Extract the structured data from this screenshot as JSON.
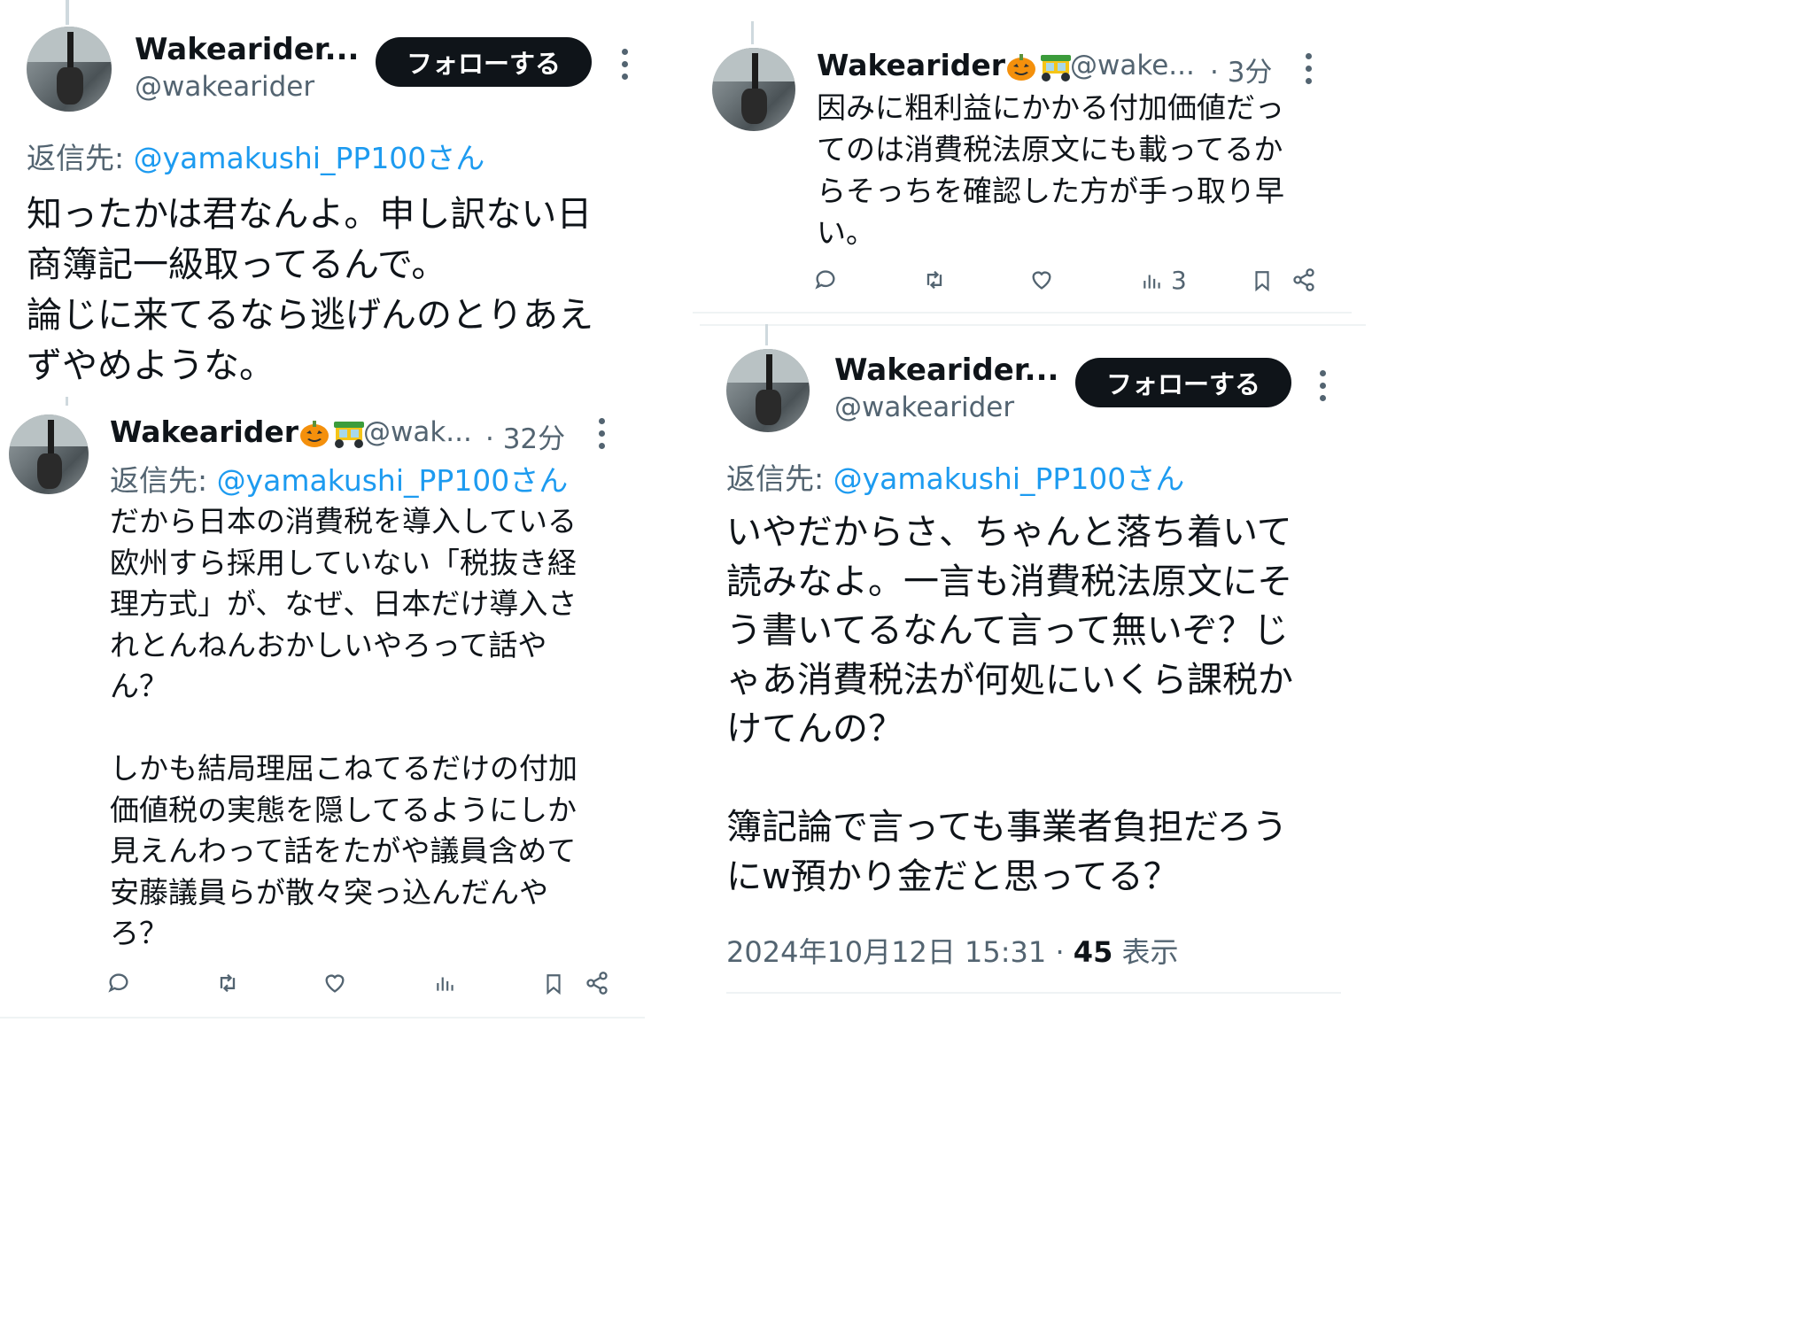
{
  "tweet_a": {
    "name": "Wakearider...",
    "handle": "@wakearider",
    "follow_label": "フォローする",
    "reply_prefix": "返信先: ",
    "reply_mention": "@yamakushi_PP100さん",
    "text": "知ったかは君なんよ。申し訳ない日\n商簿記一級取ってるんで。\n論じに来てるなら逃げんのとりあえ\nずやめような。"
  },
  "tweet_b": {
    "name": "Wakearider",
    "handle": "@wak...",
    "time": "· 32分",
    "reply_prefix": "返信先: ",
    "reply_mention": "@yamakushi_PP100さん",
    "text": "だから日本の消費税を導入している\n欧州すら採用していない「税抜き経\n理方式」が、なぜ、日本だけ導入さ\nれとんねんおかしいやろって話や\nん？\n\nしかも結局理屈こねてるだけの付加\n価値税の実態を隠してるようにしか\n見えんわって話をたがや議員含めて\n安藤議員らが散々突っ込んだんや\nろ？",
    "views": ""
  },
  "tweet_c": {
    "name": "Wakearider",
    "handle": "@wake...",
    "time": "· 3分",
    "text": "因みに粗利益にかかる付加価値だっ\nてのは消費税法原文にも載ってるか\nらそっちを確認した方が手っ取り早\nい。",
    "views": "3"
  },
  "tweet_d": {
    "name": "Wakearider...",
    "handle": "@wakearider",
    "follow_label": "フォローする",
    "reply_prefix": "返信先: ",
    "reply_mention": "@yamakushi_PP100さん",
    "text": "いやだからさ、ちゃんと落ち着いて\n読みなよ。一言も消費税法原文にそ\nう書いてるなんて言って無いぞ？じ\nゃあ消費税法が何処にいくら課税か\nけてんの？\n\n簿記論で言っても事業者負担だろう\nにw預かり金だと思ってる？",
    "timestamp": "2024年10月12日 15:31",
    "separator": " · ",
    "view_count": "45",
    "view_label": " 表示"
  },
  "icons": {
    "reply": "reply-icon",
    "retweet": "retweet-icon",
    "like": "heart-icon",
    "views": "analytics-icon",
    "bookmark": "bookmark-icon",
    "share": "share-icon",
    "more": "more-dots-icon",
    "pumpkin": "pumpkin-emoji",
    "rickshaw": "auto-rickshaw-emoji"
  },
  "colors": {
    "text": "#0f1419",
    "secondary": "#536471",
    "link": "#1d9bf0",
    "button": "#0f1419",
    "divider": "#eff3f4"
  }
}
